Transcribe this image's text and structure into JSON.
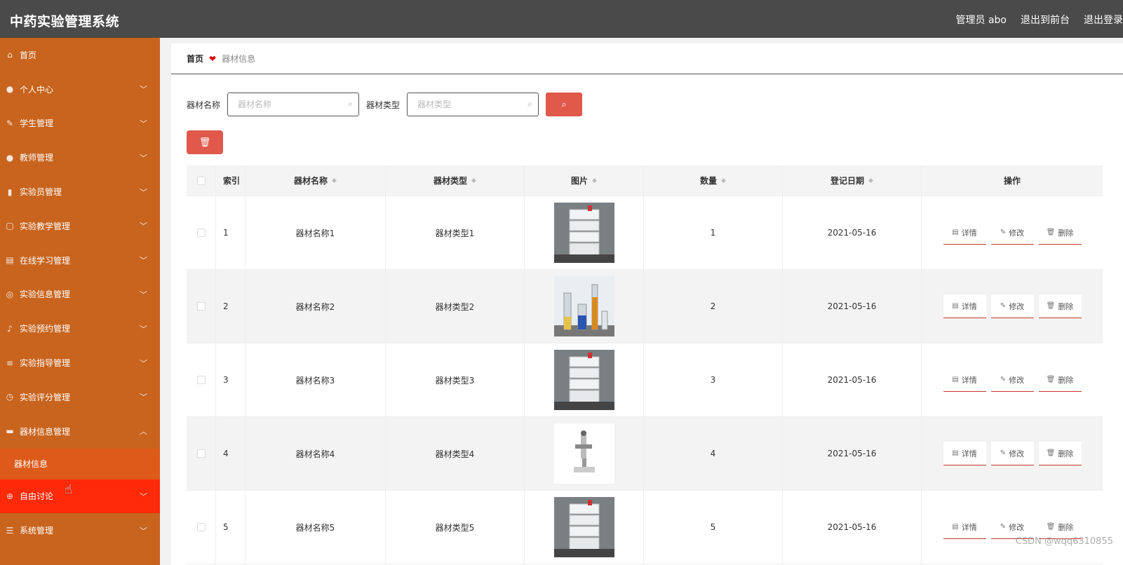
{
  "header": {
    "title": "中药实验管理系统",
    "admin_label": "管理员 abo",
    "to_front": "退出到前台",
    "logout": "退出登录"
  },
  "sidebar": {
    "items": [
      {
        "label": "首页",
        "icon": "home-icon",
        "has_chevron": false
      },
      {
        "label": "个人中心",
        "icon": "user-icon",
        "has_chevron": true
      },
      {
        "label": "学生管理",
        "icon": "leaf-icon",
        "has_chevron": true
      },
      {
        "label": "教师管理",
        "icon": "user-icon",
        "has_chevron": true
      },
      {
        "label": "实验员管理",
        "icon": "bar-chart-icon",
        "has_chevron": true
      },
      {
        "label": "实验教学管理",
        "icon": "window-icon",
        "has_chevron": true
      },
      {
        "label": "在线学习管理",
        "icon": "clipboard-icon",
        "has_chevron": true
      },
      {
        "label": "实验信息管理",
        "icon": "target-icon",
        "has_chevron": true
      },
      {
        "label": "实验预约管理",
        "icon": "mic-icon",
        "has_chevron": true
      },
      {
        "label": "实验指导管理",
        "icon": "list-icon",
        "has_chevron": true
      },
      {
        "label": "实验评分管理",
        "icon": "clock-icon",
        "has_chevron": true
      },
      {
        "label": "器材信息管理",
        "icon": "box-icon",
        "has_chevron": true,
        "expanded": true
      }
    ],
    "submenu": {
      "label": "器材信息"
    },
    "after": [
      {
        "label": "自由讨论",
        "icon": "help-icon",
        "has_chevron": true,
        "active": true
      },
      {
        "label": "系统管理",
        "icon": "sliders-icon",
        "has_chevron": true
      }
    ]
  },
  "breadcrumb": {
    "home": "首页",
    "current": "器材信息"
  },
  "search": {
    "name_label": "器材名称",
    "name_placeholder": "器材名称",
    "type_label": "器材类型",
    "type_placeholder": "器材类型"
  },
  "table": {
    "headers": {
      "index": "索引",
      "name": "器材名称",
      "type": "器材类型",
      "picture": "图片",
      "quantity": "数量",
      "date": "登记日期",
      "actions": "操作"
    },
    "rows": [
      {
        "index": "1",
        "name": "器材名称1",
        "type": "器材类型1",
        "quantity": "1",
        "date": "2021-05-16",
        "pic": "hplc"
      },
      {
        "index": "2",
        "name": "器材名称2",
        "type": "器材类型2",
        "quantity": "2",
        "date": "2021-05-16",
        "pic": "glassware"
      },
      {
        "index": "3",
        "name": "器材名称3",
        "type": "器材类型3",
        "quantity": "3",
        "date": "2021-05-16",
        "pic": "hplc"
      },
      {
        "index": "4",
        "name": "器材名称4",
        "type": "器材类型4",
        "quantity": "4",
        "date": "2021-05-16",
        "pic": "microscope"
      },
      {
        "index": "5",
        "name": "器材名称5",
        "type": "器材类型5",
        "quantity": "5",
        "date": "2021-05-16",
        "pic": "hplc"
      }
    ],
    "actions": {
      "detail": "详情",
      "edit": "修改",
      "delete": "删除"
    }
  },
  "watermark": "CSDN @wqq6310855",
  "colors": {
    "header_bg": "#4a4a4a",
    "sidebar_bg": "#c8641e",
    "active_item": "#ff2a0a",
    "submenu_bg": "#dd5a1a",
    "accent_button": "#e0594a"
  }
}
